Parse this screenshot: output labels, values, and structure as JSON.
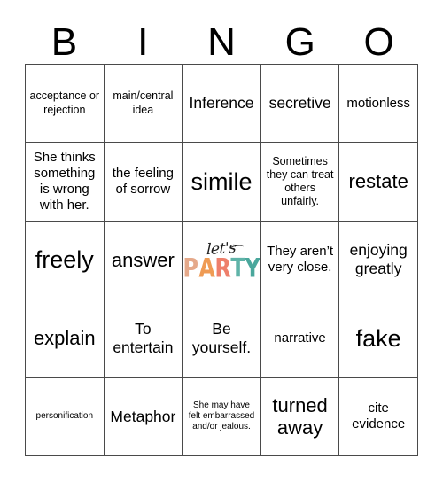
{
  "card": {
    "title": "BINGO",
    "header_letters": [
      "B",
      "I",
      "N",
      "G",
      "O"
    ],
    "grid_size": "5x5",
    "border_color": "#4a4a4a",
    "background_color": "#ffffff",
    "text_color": "#000000"
  },
  "cells": [
    {
      "id": "b1",
      "text": "acceptance or rejection",
      "size": "sm",
      "type": "text"
    },
    {
      "id": "i1",
      "text": "main/central idea",
      "size": "sm",
      "type": "text"
    },
    {
      "id": "n1",
      "text": "Inference",
      "size": "lg",
      "type": "text"
    },
    {
      "id": "g1",
      "text": "secretive",
      "size": "lg",
      "type": "text"
    },
    {
      "id": "o1",
      "text": "motionless",
      "size": "md",
      "type": "text"
    },
    {
      "id": "b2",
      "text": "She thinks something is wrong with her.",
      "size": "md",
      "type": "text"
    },
    {
      "id": "i2",
      "text": "the feeling of sorrow",
      "size": "md",
      "type": "text"
    },
    {
      "id": "n2",
      "text": "simile",
      "size": "xxl",
      "type": "text"
    },
    {
      "id": "g2",
      "text": "Sometimes they can treat others unfairly.",
      "size": "sm",
      "type": "text"
    },
    {
      "id": "o2",
      "text": "restate",
      "size": "xl",
      "type": "text"
    },
    {
      "id": "b3",
      "text": "freely",
      "size": "xxl",
      "type": "text"
    },
    {
      "id": "i3",
      "text": "answer",
      "size": "xl",
      "type": "text"
    },
    {
      "id": "n3",
      "text": "",
      "size": "md",
      "type": "image"
    },
    {
      "id": "g3",
      "text": "They aren’t very close.",
      "size": "md",
      "type": "text"
    },
    {
      "id": "o3",
      "text": "enjoying greatly",
      "size": "lg",
      "type": "text"
    },
    {
      "id": "b4",
      "text": "explain",
      "size": "xl",
      "type": "text"
    },
    {
      "id": "i4",
      "text": "To entertain",
      "size": "lg",
      "type": "text"
    },
    {
      "id": "n4",
      "text": "Be yourself.",
      "size": "lg",
      "type": "text"
    },
    {
      "id": "g4",
      "text": "narrative",
      "size": "md",
      "type": "text"
    },
    {
      "id": "o4",
      "text": "fake",
      "size": "xxl",
      "type": "text"
    },
    {
      "id": "b5",
      "text": "personification",
      "size": "xs",
      "type": "text"
    },
    {
      "id": "i5",
      "text": "Metaphor",
      "size": "lg",
      "type": "text"
    },
    {
      "id": "n5",
      "text": "She may have felt embarrassed and/or jealous.",
      "size": "xs",
      "type": "text"
    },
    {
      "id": "g5",
      "text": "turned away",
      "size": "xl",
      "type": "text"
    },
    {
      "id": "o5",
      "text": "cite evidence",
      "size": "md",
      "type": "text"
    }
  ],
  "free_space_art": {
    "script_text": "let's",
    "word_text": "PARTY",
    "letters": [
      {
        "char": "P",
        "color": "#e5a98a"
      },
      {
        "char": "A",
        "color": "#ef9b54"
      },
      {
        "char": "R",
        "color": "#ee7f6b"
      },
      {
        "char": "T",
        "color": "#5fb3a8"
      },
      {
        "char": "Y",
        "color": "#4aa79c"
      }
    ],
    "script_color": "#1c1c1c"
  }
}
